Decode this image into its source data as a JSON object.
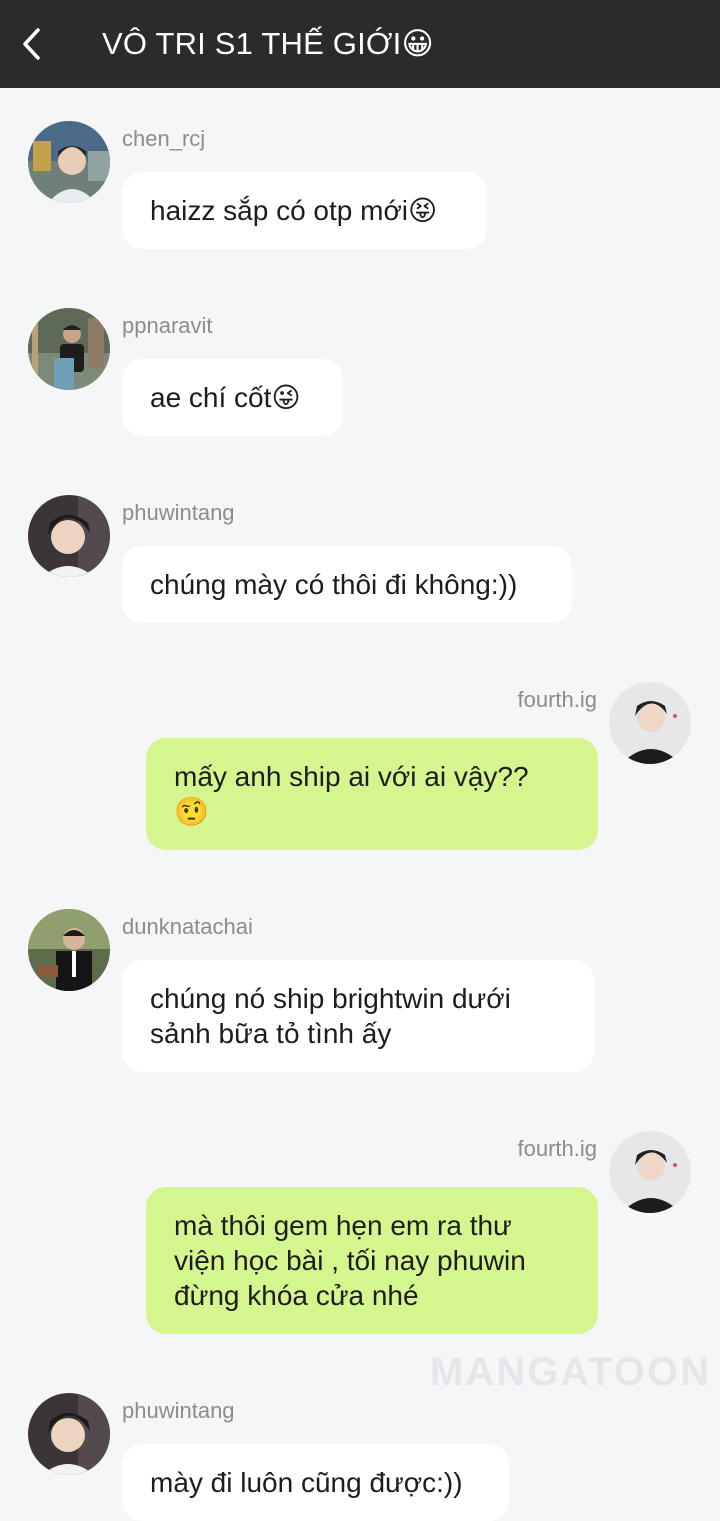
{
  "header": {
    "back_icon": "chevron-left-icon",
    "title": "VÔ TRI S1 THẾ GIỚI😀"
  },
  "messages": [
    {
      "user": "chen_rcj",
      "text": "haizz sắp có otp mới😝",
      "side": "left"
    },
    {
      "user": "ppnaravit",
      "text": "ae chí cốt😜",
      "side": "left"
    },
    {
      "user": "phuwintang",
      "text": "chúng mày có thôi đi không:))",
      "side": "left"
    },
    {
      "user": "fourth.ig",
      "text": "mấy anh ship ai với ai vậy??\n🤨",
      "side": "right"
    },
    {
      "user": "dunknatachai",
      "text": "chúng nó ship brightwin dưới\nsảnh bữa tỏ tình ấy",
      "side": "left"
    },
    {
      "user": "fourth.ig",
      "text": "mà thôi gem hẹn em ra thư\nviện học bài , tối nay phuwin\nđừng khóa cửa nhé",
      "side": "right"
    },
    {
      "user": "phuwintang",
      "text": "mày đi luôn cũng được:))",
      "side": "left"
    }
  ],
  "watermark": "MANGATOON",
  "colors": {
    "header_bg": "#2b2b2b",
    "page_bg": "#f5f6f8",
    "left_bubble": "#ffffff",
    "right_bubble": "#d5f58e",
    "username": "#8c8c8c"
  }
}
